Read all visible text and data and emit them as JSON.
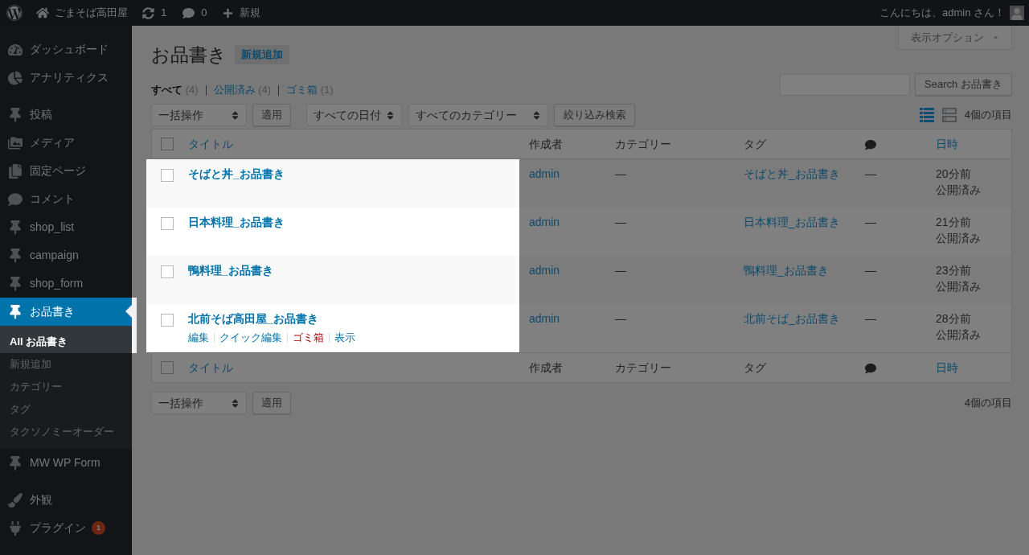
{
  "admin_bar": {
    "site_name": "ごまそば高田屋",
    "updates_count": "1",
    "comments_count": "0",
    "new_label": "新規",
    "greeting": "こんにちは、admin さん！"
  },
  "sidebar": {
    "sections": [
      {
        "items": [
          {
            "kind": "dashboard",
            "label": "ダッシュボード",
            "selected": false
          },
          {
            "kind": "analytics",
            "label": "アナリティクス",
            "selected": false
          }
        ]
      },
      {
        "items": [
          {
            "kind": "pin",
            "label": "投稿",
            "selected": false
          },
          {
            "kind": "media",
            "label": "メディア",
            "selected": false
          },
          {
            "kind": "page",
            "label": "固定ページ",
            "selected": false
          },
          {
            "kind": "comment",
            "label": "コメント",
            "selected": false
          },
          {
            "kind": "pin",
            "label": "shop_list",
            "selected": false
          },
          {
            "kind": "pin",
            "label": "campaign",
            "selected": false
          },
          {
            "kind": "pin",
            "label": "shop_form",
            "selected": false
          },
          {
            "kind": "pin",
            "label": "お品書き",
            "selected": true,
            "submenu": [
              {
                "label": "All お品書き",
                "selected": true
              },
              {
                "label": "新規追加",
                "selected": false
              },
              {
                "label": "カテゴリー",
                "selected": false
              },
              {
                "label": "タグ",
                "selected": false
              },
              {
                "label": "タクソノミーオーダー",
                "selected": false
              }
            ]
          },
          {
            "kind": "pin",
            "label": "MW WP Form",
            "selected": false
          }
        ]
      },
      {
        "items": [
          {
            "kind": "appearance",
            "label": "外観",
            "selected": false
          },
          {
            "kind": "plugin",
            "label": "プラグイン",
            "selected": false,
            "badge": "1"
          }
        ]
      }
    ]
  },
  "page": {
    "screen_options": "表示オプション",
    "title": "お品書き",
    "add_new": "新規追加"
  },
  "views": [
    {
      "label": "すべて",
      "count": "(4)",
      "selected": true
    },
    {
      "label": "公開済み",
      "count": "(4)",
      "selected": false
    },
    {
      "label": "ゴミ箱",
      "count": "(1)",
      "selected": false
    }
  ],
  "search": {
    "button": "Search お品書き"
  },
  "top_nav": {
    "bulk_action": "一括操作",
    "apply": "適用",
    "date_filter": "すべての日付",
    "category_filter": "すべてのカテゴリー",
    "filter_button": "絞り込み検索",
    "view_modes": [
      {
        "kind": "list",
        "selected": true
      },
      {
        "kind": "excerpt",
        "selected": false
      }
    ],
    "item_count": "4個の項目"
  },
  "table": {
    "title_column_spotlit": true,
    "select_all_checked": false,
    "footer_select_all_checked": false,
    "columns": [
      {
        "kind": "text",
        "label": "タイトル",
        "sortable": true
      },
      {
        "kind": "text",
        "label": "作成者",
        "sortable": false
      },
      {
        "kind": "text",
        "label": "カテゴリー",
        "sortable": false
      },
      {
        "kind": "text",
        "label": "タグ",
        "sortable": false
      },
      {
        "kind": "comments"
      },
      {
        "kind": "text",
        "label": "日時",
        "sortable": true
      }
    ],
    "rows": [
      {
        "checked": false,
        "title": "そばと丼_お品書き",
        "author": "admin",
        "category": "—",
        "tag": "そばと丼_お品書き",
        "comments": "—",
        "date": "20分前",
        "status": "公開済み"
      },
      {
        "checked": false,
        "title": "日本料理_お品書き",
        "author": "admin",
        "category": "—",
        "tag": "日本料理_お品書き",
        "comments": "—",
        "date": "21分前",
        "status": "公開済み"
      },
      {
        "checked": false,
        "title": "鴨料理_お品書き",
        "author": "admin",
        "category": "—",
        "tag": "鴨料理_お品書き",
        "comments": "—",
        "date": "23分前",
        "status": "公開済み"
      },
      {
        "checked": false,
        "title": "北前そば高田屋_お品書き",
        "author": "admin",
        "category": "—",
        "tag": "北前そば_お品書き",
        "comments": "—",
        "date": "28分前",
        "status": "公開済み",
        "actions": [
          {
            "kind": "link",
            "label": "編集"
          },
          {
            "kind": "link",
            "label": "クイック編集"
          },
          {
            "kind": "delete",
            "label": "ゴミ箱"
          },
          {
            "kind": "link",
            "label": "表示"
          }
        ]
      }
    ],
    "footer_columns": [
      {
        "kind": "text",
        "label": "タイトル",
        "sortable": true
      },
      {
        "kind": "text",
        "label": "作成者",
        "sortable": false
      },
      {
        "kind": "text",
        "label": "カテゴリー",
        "sortable": false
      },
      {
        "kind": "text",
        "label": "タグ",
        "sortable": false
      },
      {
        "kind": "comments"
      },
      {
        "kind": "text",
        "label": "日時",
        "sortable": true
      }
    ]
  },
  "bottom_nav": {
    "bulk_action": "一括操作",
    "apply": "適用",
    "item_count": "4個の項目"
  }
}
